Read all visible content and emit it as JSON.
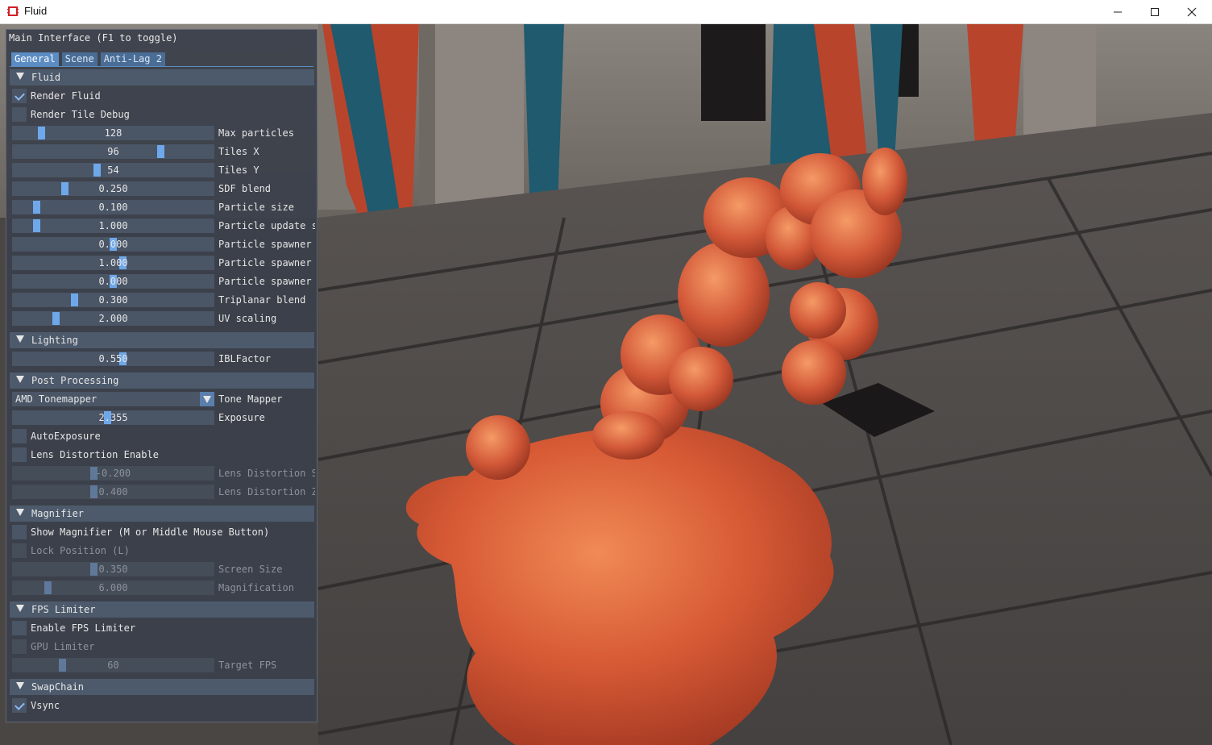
{
  "window": {
    "title": "Fluid",
    "minimize": "—",
    "maximize": "☐",
    "close": "✕"
  },
  "panel": {
    "title": "Main Interface (F1 to toggle)",
    "tabs": [
      {
        "label": "General",
        "active": true
      },
      {
        "label": "Scene",
        "active": false
      },
      {
        "label": "Anti-Lag 2",
        "active": false
      }
    ],
    "fluid": {
      "header": "Fluid",
      "render_fluid": {
        "label": "Render Fluid",
        "checked": true
      },
      "render_tile_debug": {
        "label": "Render Tile Debug",
        "checked": false
      },
      "max_particles": {
        "value": "128",
        "label": "Max particles",
        "fraction": 0.13
      },
      "tiles_x": {
        "value": "96",
        "label": "Tiles X",
        "fraction": 0.74
      },
      "tiles_y": {
        "value": "54",
        "label": "Tiles Y",
        "fraction": 0.42
      },
      "sdf_blend": {
        "value": "0.250",
        "label": "SDF blend",
        "fraction": 0.25
      },
      "particle_size": {
        "value": "0.100",
        "label": "Particle size",
        "fraction": 0.1
      },
      "particle_update": {
        "value": "1.000",
        "label": "Particle update s",
        "fraction": 0.1
      },
      "particle_spawner_1": {
        "value": "0.000",
        "label": "Particle spawner",
        "fraction": 0.5
      },
      "particle_spawner_2": {
        "value": "1.000",
        "label": "Particle spawner '",
        "fraction": 0.55
      },
      "particle_spawner_3": {
        "value": "0.000",
        "label": "Particle spawner",
        "fraction": 0.5
      },
      "triplanar_blend": {
        "value": "0.300",
        "label": "Triplanar blend",
        "fraction": 0.3
      },
      "uv_scaling": {
        "value": "2.000",
        "label": "UV scaling",
        "fraction": 0.2
      }
    },
    "lighting": {
      "header": "Lighting",
      "ibl_factor": {
        "value": "0.550",
        "label": "IBLFactor",
        "fraction": 0.55
      }
    },
    "post_processing": {
      "header": "Post Processing",
      "tone_mapper": {
        "value": "AMD Tonemapper",
        "label": "Tone Mapper"
      },
      "exposure": {
        "value": "2.355",
        "label": "Exposure",
        "fraction": 0.47
      },
      "auto_exposure": {
        "label": "AutoExposure",
        "checked": false
      },
      "lens_distortion_enable": {
        "label": "Lens Distortion Enable",
        "checked": false
      },
      "lens_distortion_s": {
        "value": "-0.200",
        "label": "Lens Distortion S",
        "fraction": 0.4
      },
      "lens_distortion_z": {
        "value": "0.400",
        "label": "Lens Distortion Z",
        "fraction": 0.4
      }
    },
    "magnifier": {
      "header": "Magnifier",
      "show_magnifier": {
        "label": "Show Magnifier (M or Middle Mouse Button)",
        "checked": false
      },
      "lock_position": {
        "label": "Lock Position (L)",
        "checked": false
      },
      "screen_size": {
        "value": "0.350",
        "label": "Screen Size",
        "fraction": 0.4
      },
      "magnification": {
        "value": "6.000",
        "label": "Magnification",
        "fraction": 0.18
      }
    },
    "fps_limiter": {
      "header": "FPS Limiter",
      "enable_fps_limiter": {
        "label": "Enable FPS Limiter",
        "checked": false
      },
      "gpu_limiter": {
        "label": "GPU Limiter",
        "checked": false
      },
      "target_fps": {
        "value": "60",
        "label": "Target FPS",
        "fraction": 0.25
      }
    },
    "swapchain": {
      "header": "SwapChain",
      "vsync": {
        "label": "Vsync",
        "checked": true
      }
    }
  },
  "colors": {
    "panel_bg": "#3a404a",
    "header_bg": "#4d5a6c",
    "accent": "#6ea8ea",
    "fluid_orange": "#e0603a"
  }
}
